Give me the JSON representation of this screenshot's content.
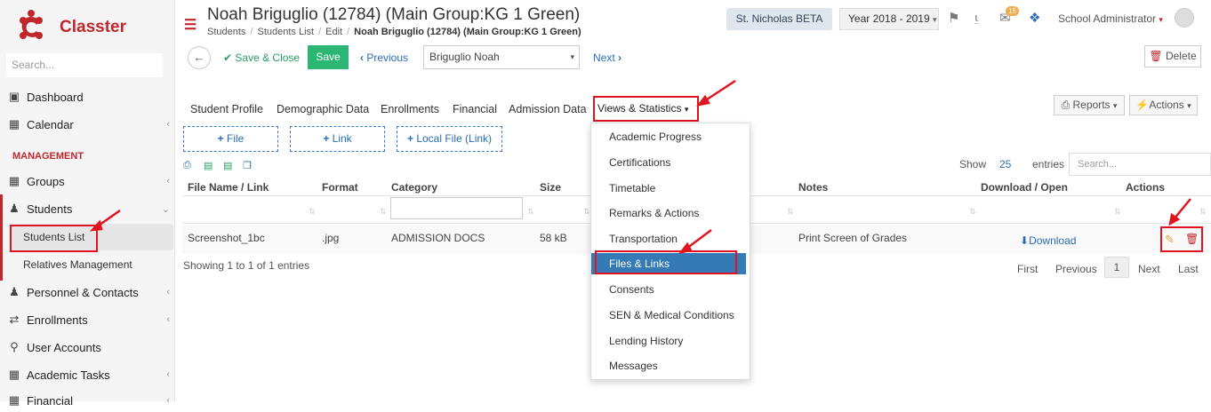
{
  "sidebar": {
    "brand": "Classter",
    "search_placeholder": "Search...",
    "items": [
      {
        "label": "Dashboard",
        "icon": "laptop-icon"
      },
      {
        "label": "Calendar",
        "icon": "calendar-icon"
      }
    ],
    "section_label": "MANAGEMENT",
    "management_items": [
      {
        "label": "Groups",
        "icon": "groups-icon"
      },
      {
        "label": "Students",
        "icon": "students-icon"
      },
      {
        "label": "Students List"
      },
      {
        "label": "Relatives Management"
      },
      {
        "label": "Personnel & Contacts",
        "icon": "personnel-icon"
      },
      {
        "label": "Enrollments",
        "icon": "enrollments-icon"
      },
      {
        "label": "User Accounts",
        "icon": "key-icon"
      },
      {
        "label": "Academic Tasks",
        "icon": "tasks-icon"
      },
      {
        "label": "Financial",
        "icon": "financial-icon"
      }
    ]
  },
  "header": {
    "title": "Noah Briguglio (12784) (Main Group:KG 1 Green)",
    "breadcrumb": [
      "Students",
      "Students List",
      "Edit"
    ],
    "breadcrumb_current": "Noah Briguglio (12784) (Main Group:KG 1 Green)",
    "school": "St. Nicholas BETA",
    "year": "Year 2018 - 2019",
    "mail_count": "15",
    "user": "School Administrator"
  },
  "toolbar": {
    "save_close": "Save & Close",
    "save": "Save",
    "previous": "Previous",
    "student_select": "Briguglio Noah",
    "next": "Next",
    "delete": "Delete"
  },
  "tabs": [
    "Student Profile",
    "Demographic Data",
    "Enrollments",
    "Financial",
    "Admission Data",
    "Views & Statistics"
  ],
  "tab_buttons": {
    "reports": "Reports",
    "actions": "Actions"
  },
  "add_buttons": {
    "file": "File",
    "link": "Link",
    "local_file": "Local File (Link)"
  },
  "table": {
    "show_label": "Show",
    "show_value": "25",
    "entries_label": "entries",
    "search_placeholder": "Search...",
    "headers": {
      "file": "File Name / Link",
      "format": "Format",
      "category": "Category",
      "size": "Size",
      "notes": "Notes",
      "download": "Download / Open",
      "actions": "Actions"
    },
    "row": {
      "file": "Screenshot_1bc",
      "format": ".jpg",
      "category": "ADMISSION DOCS",
      "size": "58 kB",
      "notes": "Print Screen of Grades",
      "download": "Download"
    },
    "showing": "Showing 1 to 1 of 1 entries",
    "pagination": {
      "first": "First",
      "previous": "Previous",
      "page": "1",
      "next": "Next",
      "last": "Last"
    }
  },
  "dropdown": {
    "items": [
      "Academic Progress",
      "Certifications",
      "Timetable",
      "Remarks & Actions",
      "Transportation"
    ],
    "selected": "Files & Links",
    "items_after": [
      "Consents",
      "SEN & Medical Conditions",
      "Lending History",
      "Messages"
    ]
  },
  "colors": {
    "brand_red": "#c0272d",
    "save_green": "#2bb673",
    "link_blue": "#2a6db5",
    "selected_blue": "#337ab7",
    "annotation_red": "#e0141f"
  }
}
